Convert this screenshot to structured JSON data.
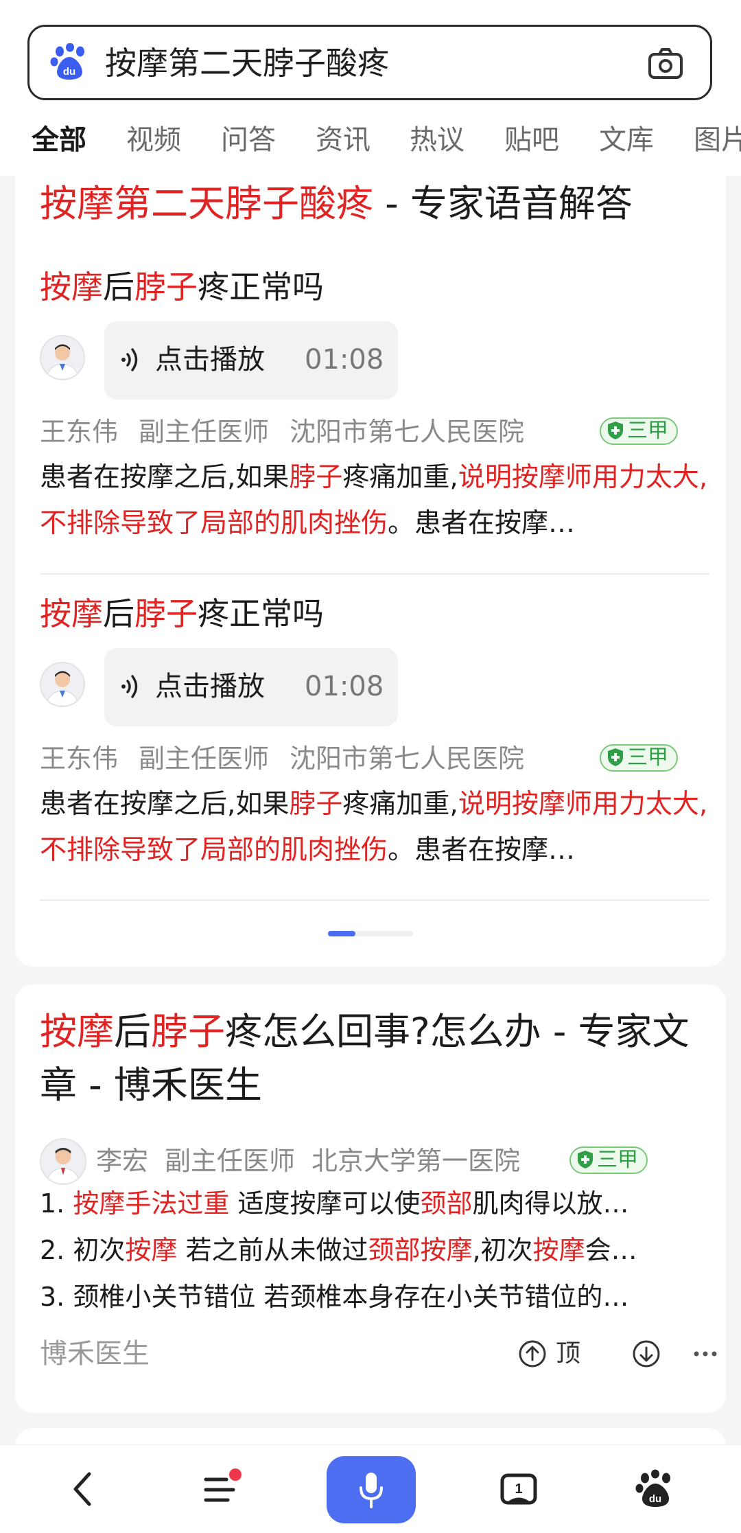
{
  "search": {
    "query": "按摩第二天脖子酸疼"
  },
  "tabs": [
    "全部",
    "视频",
    "问答",
    "资讯",
    "热议",
    "贴吧",
    "文库",
    "图片"
  ],
  "expert_card": {
    "title_highlight": "按摩第二天脖子酸疼",
    "title_rest": " - 专家语音解答",
    "items": [
      {
        "q_parts": [
          "按摩",
          "后",
          "脖子",
          "疼正常吗"
        ],
        "audio_label": "点击播放",
        "audio_duration": "01:08",
        "doctor": "王东伟",
        "rank": "副主任医师",
        "hospital": "沈阳市第七人民医院",
        "badge": "三甲",
        "snippet_parts": [
          "患者在按摩之后,如果",
          "脖子",
          "疼痛加重,",
          "说明按摩师用力太大,不排除导致了局部的肌肉挫伤",
          "。患者在按摩…"
        ]
      },
      {
        "q_parts": [
          "按摩",
          "后",
          "脖子",
          "疼正常吗"
        ],
        "audio_label": "点击播放",
        "audio_duration": "01:08",
        "doctor": "王东伟",
        "rank": "副主任医师",
        "hospital": "沈阳市第七人民医院",
        "badge": "三甲",
        "snippet_parts": [
          "患者在按摩之后,如果",
          "脖子",
          "疼痛加重,",
          "说明按摩师用力太大,不排除导致了局部的肌肉挫伤",
          "。患者在按摩…"
        ]
      }
    ]
  },
  "article_card": {
    "title_parts": [
      "按摩",
      "后",
      "脖子",
      "疼怎么回事?怎么办 - 专家文章 - 博禾医生"
    ],
    "author": "李宏",
    "rank": "副主任医师",
    "hospital": "北京大学第一医院",
    "badge": "三甲",
    "lines": [
      [
        "1. ",
        "按摩手法过重",
        " 适度按摩可以使",
        "颈部",
        "肌肉得以放…"
      ],
      [
        "2. 初次",
        "按摩",
        " 若之前从未做过",
        "颈部按摩",
        ",初次",
        "按摩",
        "会…"
      ],
      [
        "3. 颈椎小关节错位 若颈椎本身存在小关节错位的…"
      ]
    ],
    "source": "博禾医生",
    "up_label": "顶"
  },
  "bottom_nav": [
    "back-icon",
    "menu-icon",
    "mic-icon",
    "tabs-icon",
    "baidu-home-icon"
  ],
  "colors": {
    "highlight": "#e02424",
    "accent": "#4e6ef2",
    "badge_green": "#2e9e47"
  }
}
